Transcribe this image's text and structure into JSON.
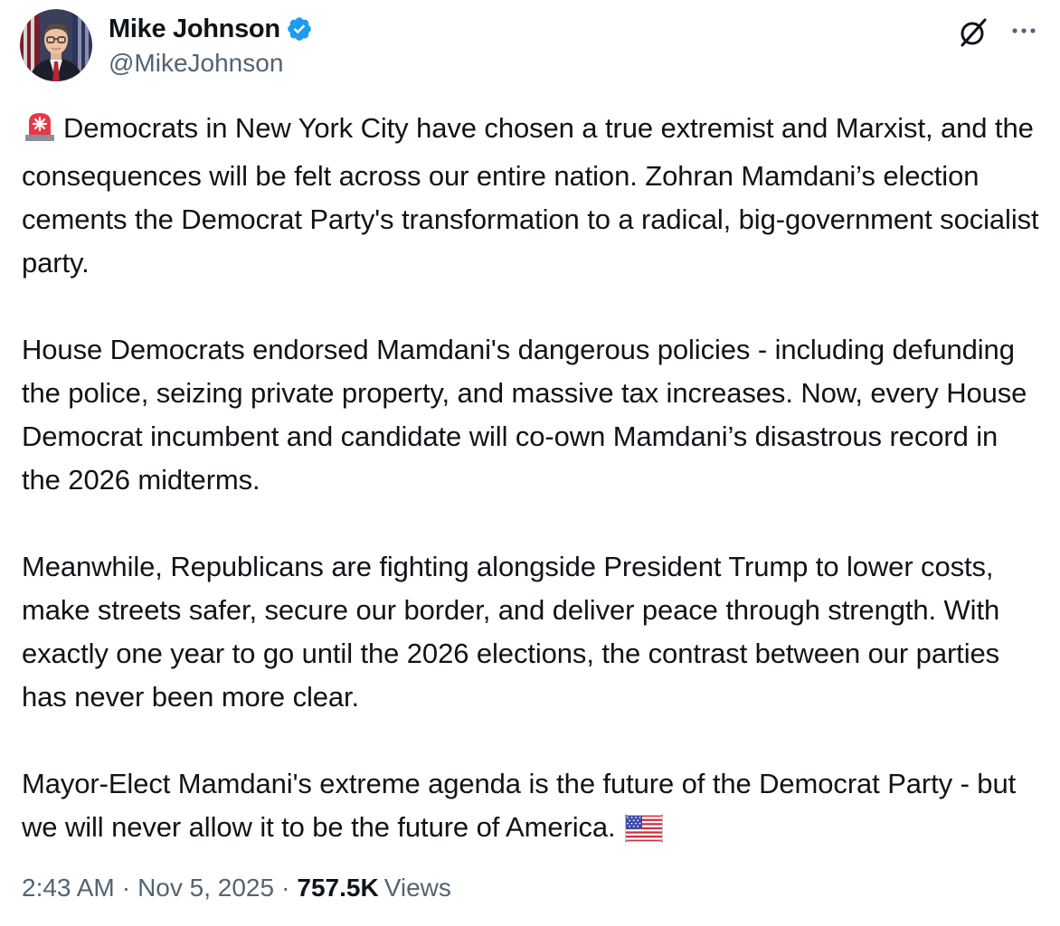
{
  "author": {
    "display_name": "Mike Johnson",
    "handle": "@MikeJohnson",
    "verified": true,
    "verified_color": "#1d9bf0"
  },
  "header_icons": {
    "grok": "grok-icon",
    "more": "more-icon"
  },
  "tweet": {
    "paragraphs": [
      "Democrats in New York City have chosen a true extremist and Marxist, and the consequences will be felt across our entire nation. Zohran Mamdani’s election cements the Democrat Party's transformation to a radical, big-government socialist party.",
      "House Democrats endorsed Mamdani's dangerous policies - including defunding the police, seizing private property, and massive tax increases. Now, every House Democrat incumbent and candidate will co-own Mamdani’s disastrous record in the 2026 midterms.",
      "Meanwhile, Republicans are fighting alongside President Trump to lower costs, make streets safer, secure our border, and deliver peace through strength. With exactly one year to go until the 2026 elections, the contrast between our parties has never been more clear.",
      "Mayor-Elect Mamdani's extreme agenda is the future of the Democrat Party - but we will never allow it to be the future of America."
    ],
    "leading_emoji": "police-light-emoji",
    "trailing_emoji": "us-flag-emoji"
  },
  "meta": {
    "time": "2:43 AM",
    "separator": "·",
    "date": "Nov 5, 2025",
    "views_count": "757.5K",
    "views_label": "Views"
  },
  "colors": {
    "text": "#0f1419",
    "secondary": "#536471",
    "accent": "#1d9bf0"
  }
}
